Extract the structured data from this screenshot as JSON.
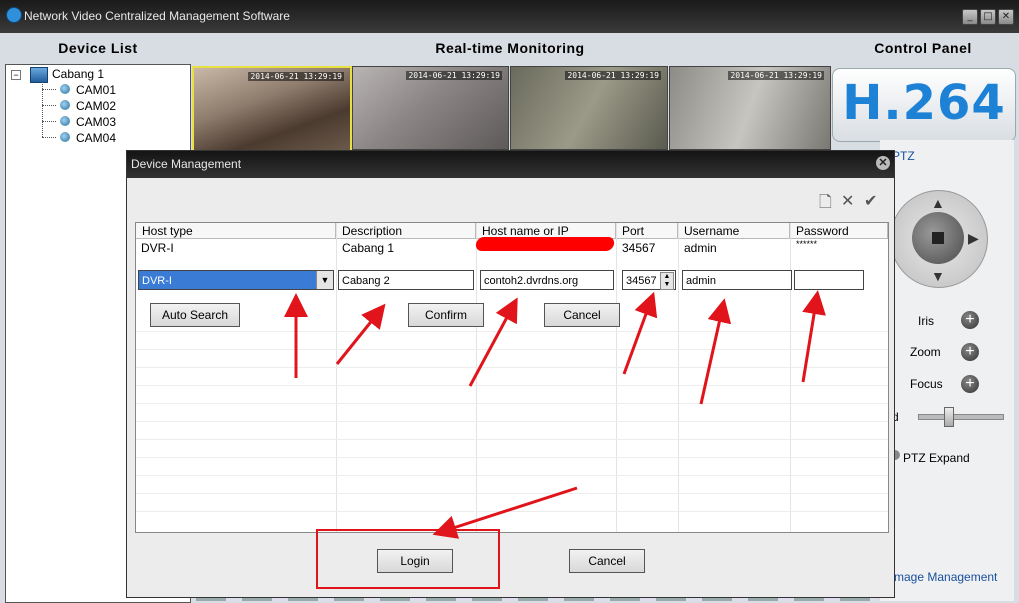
{
  "window": {
    "title": "Network Video Centralized Management Software",
    "controls": [
      "_",
      "□",
      "✕"
    ]
  },
  "sections": {
    "device_list": "Device List",
    "realtime": "Real-time Monitoring",
    "control_panel": "Control Panel"
  },
  "tree": {
    "root": "Cabang 1",
    "cams": [
      "CAM01",
      "CAM02",
      "CAM03",
      "CAM04"
    ]
  },
  "video_tiles": [
    {
      "timestamp": "2014-06-21 13:29:19"
    },
    {
      "timestamp": "2014-06-21 13:29:19"
    },
    {
      "timestamp": "2014-06-21 13:29:19"
    },
    {
      "timestamp": "2014-06-21 13:29:19"
    }
  ],
  "control_panel": {
    "logo": "H.264",
    "ptz": "PTZ",
    "iris": "Iris",
    "zoom": "Zoom",
    "focus": "Focus",
    "speed_fragment": "d",
    "ptz_expand": "PTZ Expand",
    "image_management": "mage Management"
  },
  "dialog": {
    "title": "Device Management",
    "columns": [
      "Host type",
      "Description",
      "Host name or IP",
      "Port",
      "Username",
      "Password"
    ],
    "existing_row": {
      "host_type": "DVR-I",
      "description": "Cabang 1",
      "host": "",
      "port": "34567",
      "username": "admin",
      "password": "******"
    },
    "edit_row": {
      "host_type": "DVR-I",
      "description": "Cabang 2",
      "host": "contoh2.dvrdns.org",
      "port": "34567",
      "username": "admin",
      "password": ""
    },
    "buttons": {
      "auto_search": "Auto Search",
      "confirm": "Confirm",
      "cancel_row": "Cancel",
      "login": "Login",
      "cancel": "Cancel"
    }
  },
  "colors": {
    "annotation_red": "#e0141a",
    "selection_blue": "#3a7bd5",
    "h264_blue": "#1d82d6"
  }
}
